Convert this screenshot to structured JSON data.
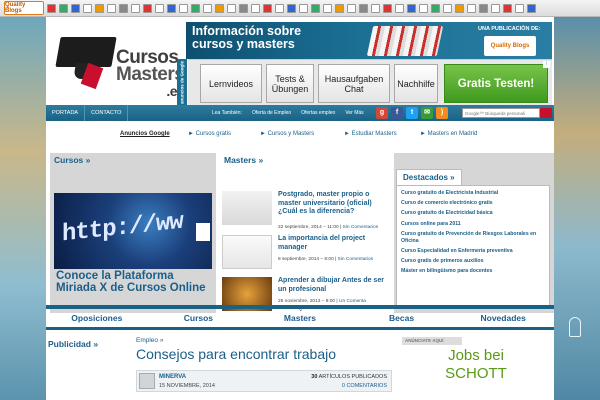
{
  "toolbar": {
    "logo_label": "Quality Blogs"
  },
  "banner": {
    "headline_line1": "Información sobre",
    "headline_line2": "cursos y masters",
    "publication_label": "UNA PUBLICACIÓN DE:",
    "publisher": "Quality Blogs",
    "vertical_label": "anuncios de Google"
  },
  "logo": {
    "line1": "Cursos",
    "line2": "Masters",
    "line3": ".es"
  },
  "adbar": {
    "buttons": [
      "Lernvideos",
      "Tests & Übungen",
      "Hausaufgaben Chat",
      "Nachhilfe",
      "Gratis Testen!"
    ]
  },
  "navbar": {
    "items": [
      "PORTADA",
      "CONTACTO"
    ],
    "also_label": "Lea También:",
    "also_links": [
      "Oferta de Empleo",
      "Ofertas empleo",
      "Ver Más"
    ],
    "search_placeholder": "Google™ Búsqueda personali"
  },
  "adlinks": {
    "title": "Anuncios Google",
    "links": [
      "► Cursos gratis",
      "► Cursos y Masters",
      "► Estudiar Masters",
      "► Masters en Madrid"
    ]
  },
  "cursos": {
    "title": "Cursos »",
    "image_text": "http://ww",
    "caption": "Conoce la Plataforma Miriada X de Cursos Online"
  },
  "masters": {
    "title": "Masters »",
    "items": [
      {
        "title": "Postgrado, master propio o master universitario (oficial) ¿Cuál es la diferencia?",
        "date": "22 septiembre, 2014 – 11:00 | ",
        "comments": "Sin Comentarios"
      },
      {
        "title": "La importancia del project manager",
        "date": "8 septiembre, 2014 – 8:00 | ",
        "comments": "Sin Comentarios"
      },
      {
        "title": "Aprender a dibujar Antes de ser un profesional",
        "date": "25 noviembre, 2013 – 8:00 | ",
        "comments": "Un Comenta"
      }
    ],
    "arrows": "⌃ ⌄"
  },
  "destacados": {
    "title": "Destacados »",
    "items": [
      "Curso gratuito de Electricista Industrial",
      "Curso de comercio electrónico gratis",
      "Curso gratuito de Electricidad básica",
      "Cursos online para 2011",
      "Curso gratuito de Prevención de Riesgos Laborales en Oficina",
      "Curso Especialidad en Enfermería preventiva",
      "Curso gratis de primeros auxilios",
      "Máster en bilingüismo para docentes"
    ]
  },
  "categories": [
    "Oposiciones",
    "Cursos",
    "Masters",
    "Becas",
    "Novedades"
  ],
  "publicidad": {
    "title": "Publicidad »"
  },
  "article": {
    "category": "Empleo »",
    "title": "Consejos para encontrar trabajo",
    "author": "MINERVA",
    "date": "15 NOVIEMBRE, 2014",
    "count_num": "30",
    "count_label": " ARTÍCULOS PUBLICADOS",
    "comments": "0 COMENTARIOS"
  },
  "ad_right": {
    "label": "ANÚNCIATE AQUÍ",
    "line1": "Jobs bei",
    "line2": "SCHOTT"
  },
  "colors": {
    "brand_blue": "#1a5f8a",
    "nav_blue": "#1a6285",
    "green_cta": "#3f9a1e",
    "accent_red": "#c8102e"
  }
}
